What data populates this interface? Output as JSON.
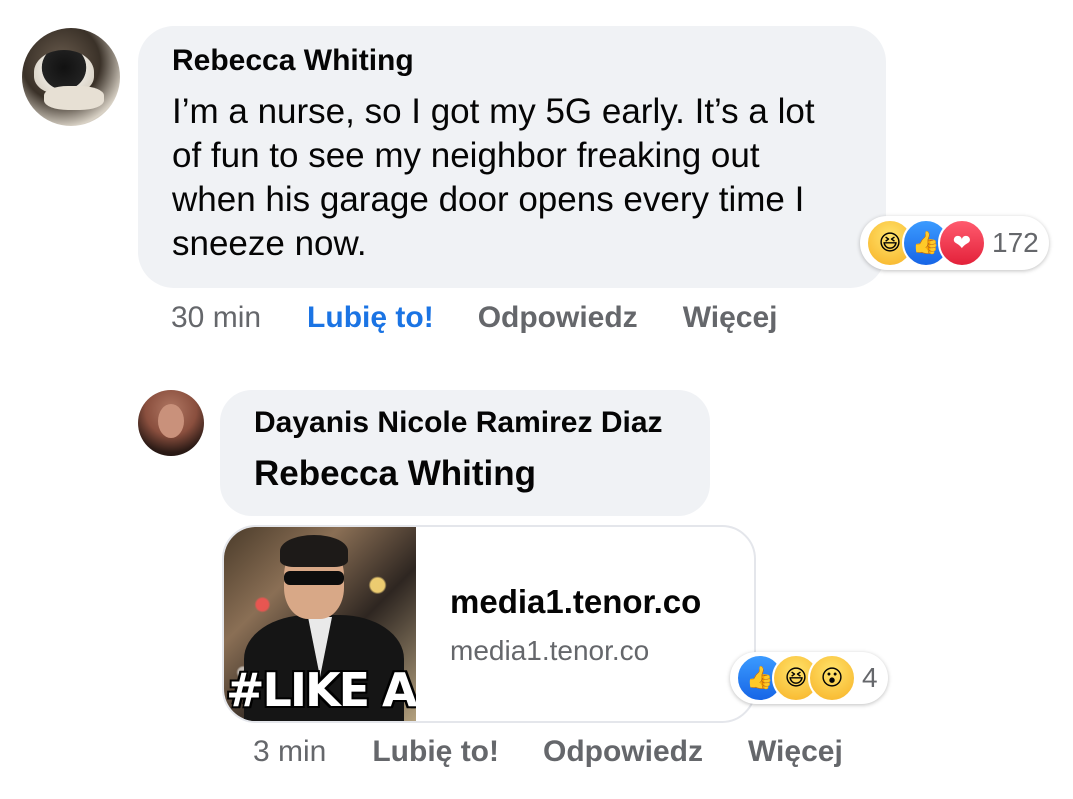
{
  "comment1": {
    "author": "Rebecca Whiting",
    "text": "I’m a nurse, so I got my 5G early. It’s a lot of fun to see my neighbor freaking out when his garage door opens every time I sneeze now.",
    "reactions": {
      "icons": [
        "haha-icon",
        "like-icon",
        "love-icon"
      ],
      "count": "172"
    },
    "time": "30 min",
    "like_label": "Lubię to!",
    "reply_label": "Odpowiedz",
    "more_label": "Więcej",
    "liked": true
  },
  "reply1": {
    "author": "Dayanis Nicole Ramirez Diaz",
    "mention": "Rebecca Whiting",
    "link": {
      "title": "media1.tenor.co",
      "domain": "media1.tenor.co",
      "gif_caption": "#LIKE A BO"
    },
    "reactions": {
      "icons": [
        "like-icon",
        "haha-icon",
        "wow-icon"
      ],
      "count": "4"
    },
    "time": "3 min",
    "like_label": "Lubię to!",
    "reply_label": "Odpowiedz",
    "more_label": "Więcej"
  },
  "colors": {
    "bubble": "#f0f2f5",
    "accent_blue": "#1b74e4",
    "secondary_text": "#65676b"
  }
}
